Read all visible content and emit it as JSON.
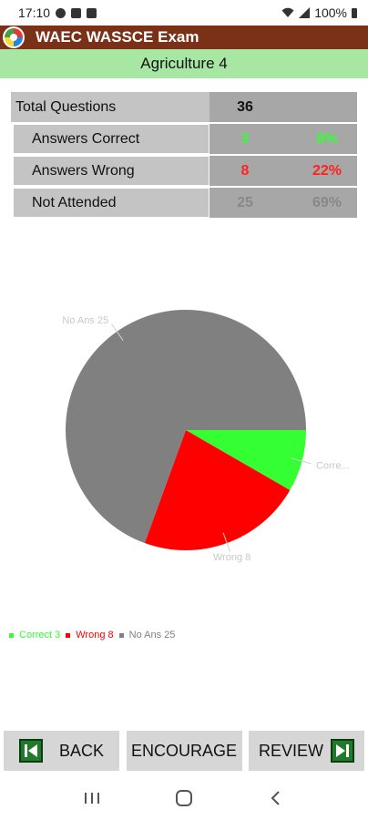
{
  "status_bar": {
    "time": "17:10",
    "battery": "100%"
  },
  "app": {
    "title": "WAEC WASSCE Exam"
  },
  "subject": {
    "title": "Agriculture 4"
  },
  "stats": {
    "total": {
      "label": "Total Questions",
      "count": "36"
    },
    "correct": {
      "label": "Answers Correct",
      "count": "3",
      "percent": "8%"
    },
    "wrong": {
      "label": "Answers Wrong",
      "count": "8",
      "percent": "22%"
    },
    "not_attended": {
      "label": "Not Attended",
      "count": "25",
      "percent": "69%"
    }
  },
  "colors": {
    "correct": "#33ff33",
    "wrong": "#ff0000",
    "no_ans": "#808080",
    "app_bar": "#7b3118",
    "subject_bar": "#a8e6a3"
  },
  "chart_data": {
    "type": "pie",
    "categories": [
      "Correct",
      "Wrong",
      "No Ans"
    ],
    "values": [
      3,
      8,
      25
    ],
    "slice_labels": [
      "Corre...",
      "Wrong 8",
      "No Ans 25"
    ],
    "legend": [
      "Correct 3",
      "Wrong 8",
      "No Ans 25"
    ],
    "colors": [
      "#33ff33",
      "#ff0000",
      "#808080"
    ],
    "legend_placement": "bottom-left"
  },
  "buttons": {
    "back": "BACK",
    "encourage": "ENCOURAGE",
    "review": "REVIEW"
  },
  "icons": {
    "back": "first-page-icon",
    "review": "last-page-icon"
  }
}
